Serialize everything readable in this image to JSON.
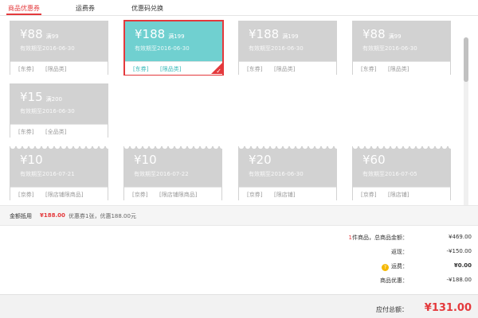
{
  "tabs": [
    {
      "label": "商品优惠券",
      "active": true
    },
    {
      "label": "运费券",
      "active": false
    },
    {
      "label": "优惠码兑换",
      "active": false
    }
  ],
  "coupons_top": [
    {
      "amount": "¥88",
      "condition": "满99",
      "validity": "有效期至2016-06-30",
      "tags": [
        "[东券]",
        "[限品类]"
      ],
      "selected": false
    },
    {
      "amount": "¥188",
      "condition": "满199",
      "validity": "有效期至2016-06-30",
      "tags": [
        "[东券]",
        "[限品类]"
      ],
      "selected": true
    },
    {
      "amount": "¥188",
      "condition": "满199",
      "validity": "有效期至2016-06-30",
      "tags": [
        "[东券]",
        "[限品类]"
      ],
      "selected": false
    },
    {
      "amount": "¥88",
      "condition": "满99",
      "validity": "有效期至2016-06-30",
      "tags": [
        "[东券]",
        "[限品类]"
      ],
      "selected": false
    },
    {
      "amount": "¥15",
      "condition": "满200",
      "validity": "有效期至2016-06-30",
      "tags": [
        "[东券]",
        "[全品类]"
      ],
      "selected": false
    }
  ],
  "coupons_bottom": [
    {
      "amount": "¥10",
      "condition": "",
      "validity": "有效期至2016-07-21",
      "tags": [
        "[京券]",
        "[限店铺限商品]"
      ]
    },
    {
      "amount": "¥10",
      "condition": "",
      "validity": "有效期至2016-07-22",
      "tags": [
        "[京券]",
        "[限店铺限商品]"
      ]
    },
    {
      "amount": "¥20",
      "condition": "",
      "validity": "有效期至2016-06-30",
      "tags": [
        "[京券]",
        "[限店铺]"
      ]
    },
    {
      "amount": "¥60",
      "condition": "",
      "validity": "有效期至2016-07-05",
      "tags": [
        "[京券]",
        "[限店铺]"
      ]
    }
  ],
  "summary": {
    "label": "金额抵用",
    "amount": "¥188.00",
    "info": "优惠券1张，优惠188.00元"
  },
  "totals": [
    {
      "key_prefix": "1",
      "key": "件商品，总商品金额：",
      "value": "¥469.00",
      "has_help": false
    },
    {
      "key_prefix": "",
      "key": "返现：",
      "value": "-¥150.00",
      "has_help": false
    },
    {
      "key_prefix": "",
      "key": "运费：",
      "value": "¥0.00",
      "has_help": true
    },
    {
      "key_prefix": "",
      "key": "商品优惠：",
      "value": "-¥188.00",
      "has_help": false
    }
  ],
  "payable": {
    "label": "应付总额：",
    "amount": "¥131.00"
  },
  "colors": {
    "accent_red": "#e4393c",
    "coupon_gray": "#d2d2d2",
    "coupon_selected": "#70d0d0"
  }
}
